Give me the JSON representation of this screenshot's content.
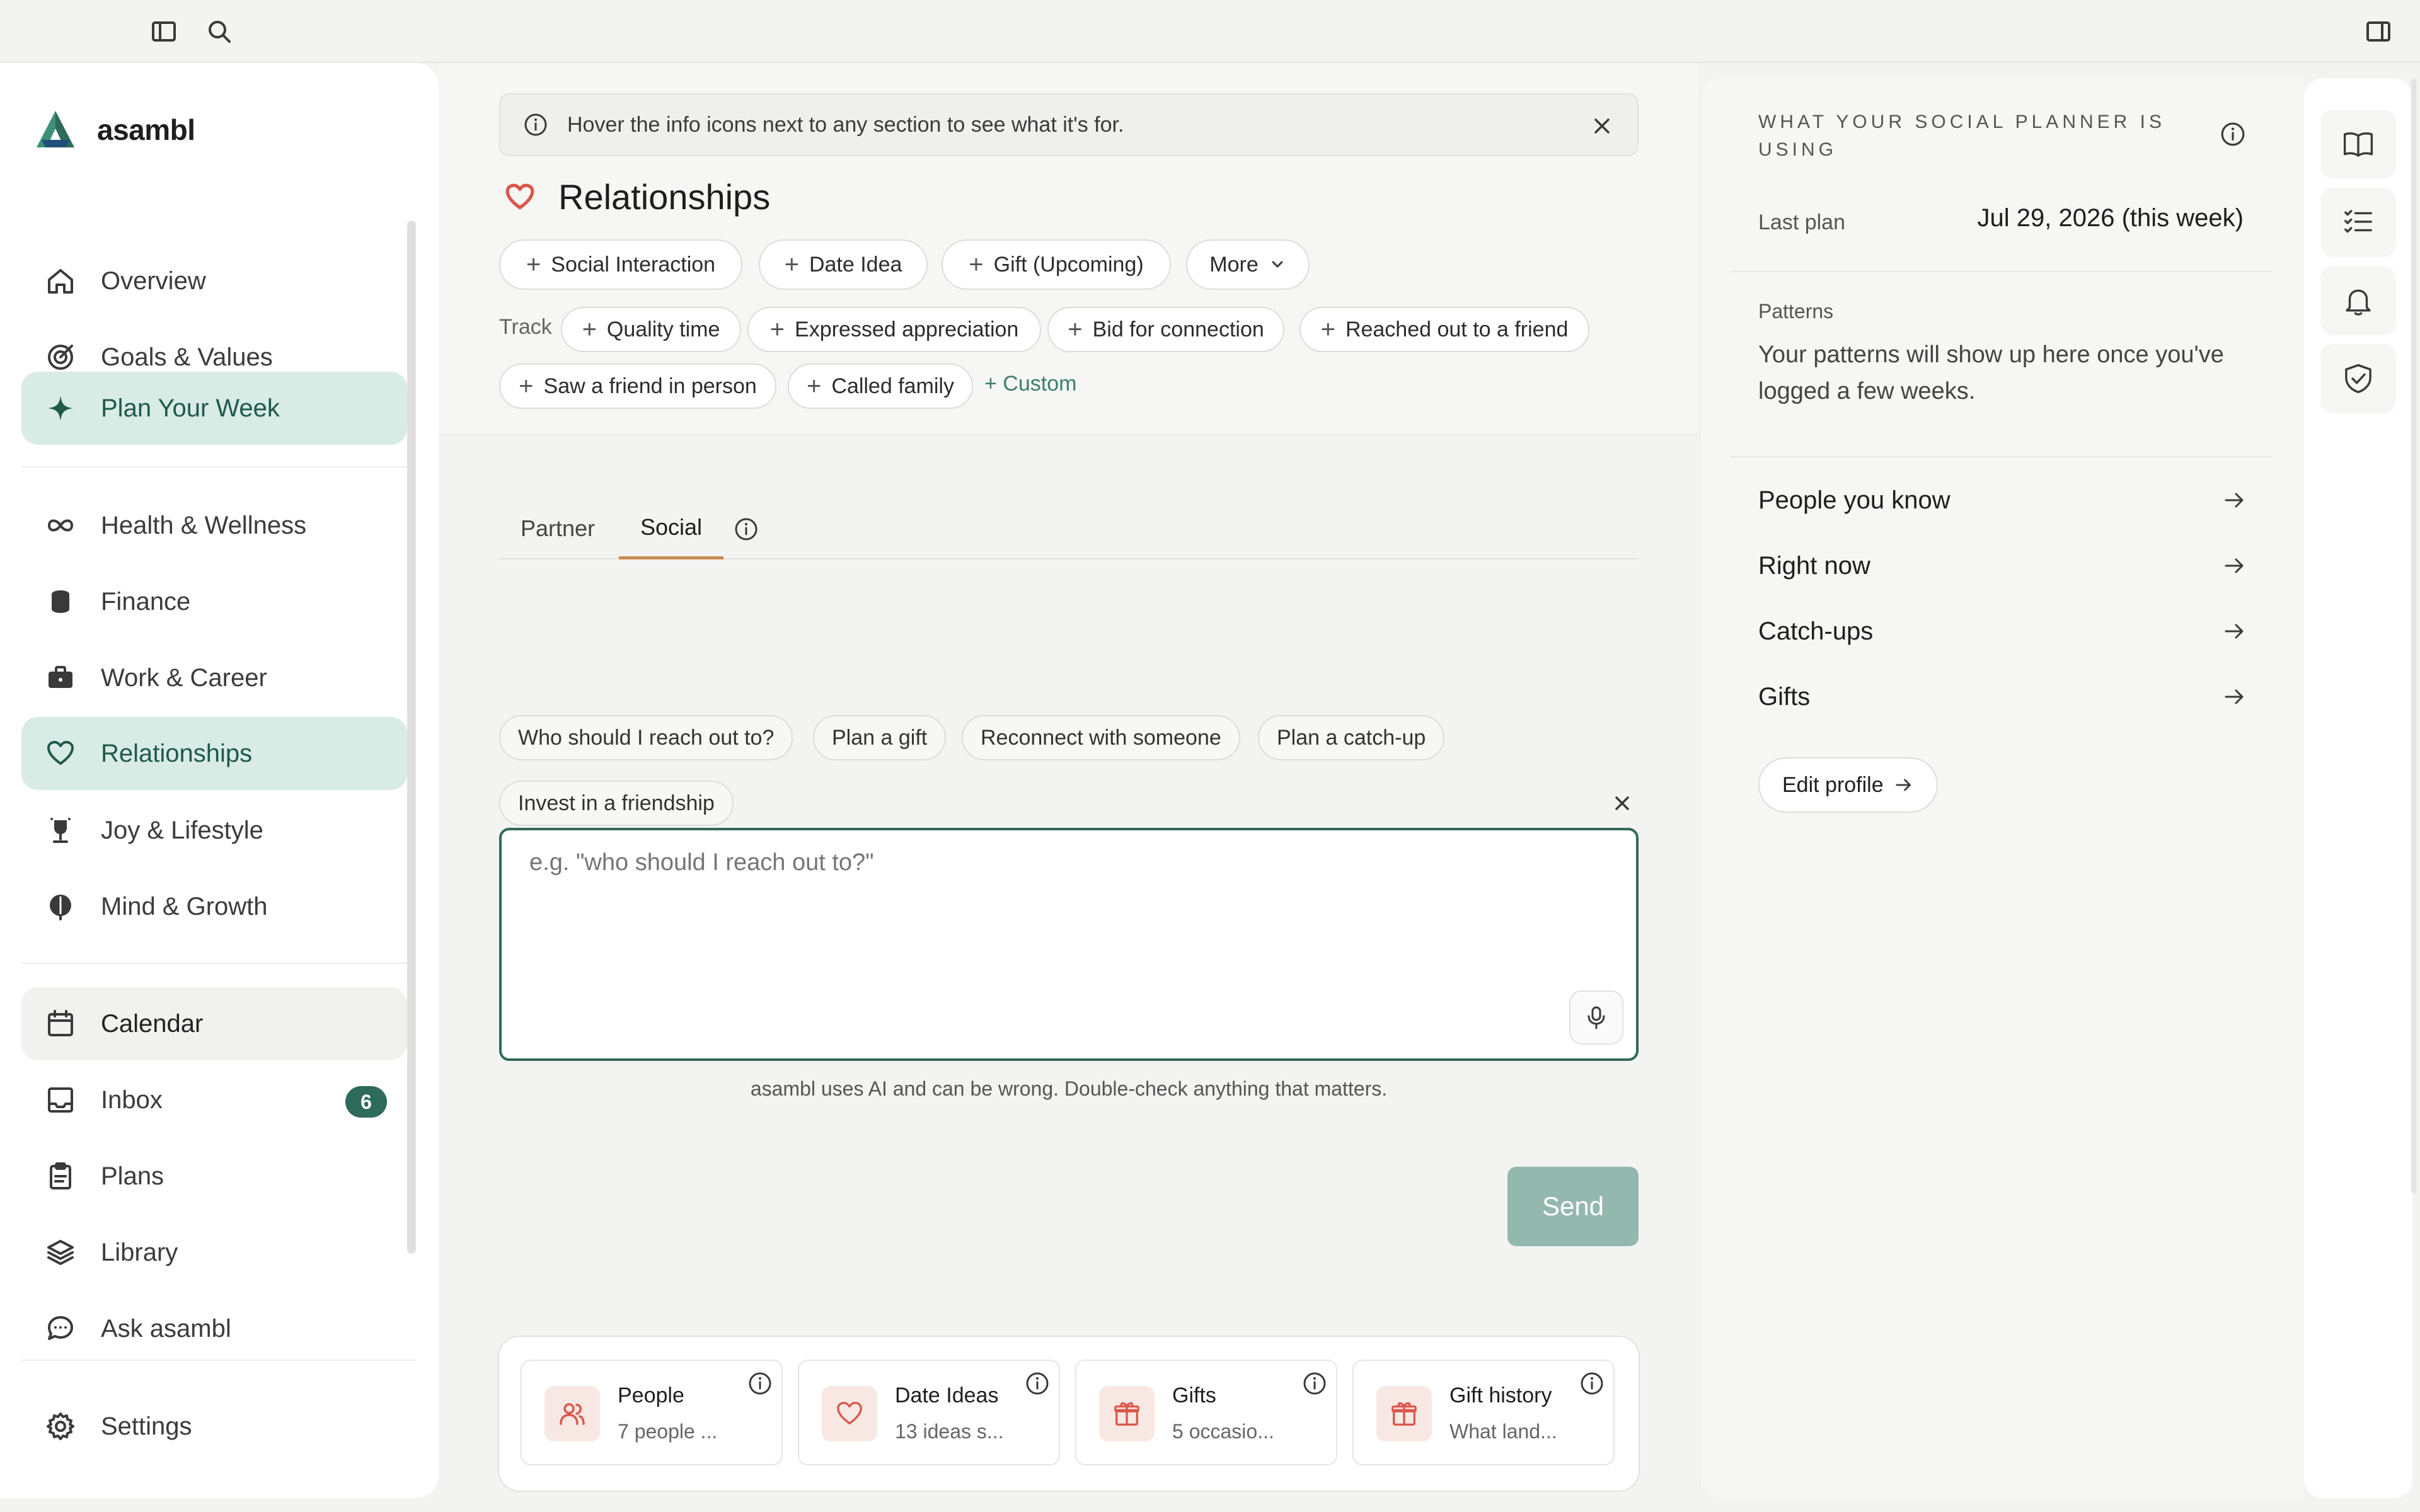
{
  "app": {
    "name": "asambl"
  },
  "nav": {
    "primary": [
      {
        "label": "Overview",
        "icon": "home-icon"
      },
      {
        "label": "Goals & Values",
        "icon": "target-icon"
      },
      {
        "label": "Plan Your Week",
        "icon": "sparkle-icon"
      }
    ],
    "areas": [
      {
        "label": "Health & Wellness",
        "icon": "infinity-icon"
      },
      {
        "label": "Finance",
        "icon": "coins-icon"
      },
      {
        "label": "Work & Career",
        "icon": "briefcase-icon"
      },
      {
        "label": "Relationships",
        "icon": "heart-icon"
      },
      {
        "label": "Joy & Lifestyle",
        "icon": "trophy-icon"
      },
      {
        "label": "Mind & Growth",
        "icon": "brain-icon"
      }
    ],
    "tools": [
      {
        "label": "Calendar",
        "icon": "calendar-icon"
      },
      {
        "label": "Inbox",
        "icon": "inbox-icon",
        "badge": "6"
      },
      {
        "label": "Plans",
        "icon": "clipboard-icon"
      },
      {
        "label": "Library",
        "icon": "layers-icon"
      },
      {
        "label": "Ask asambl",
        "icon": "chat-icon"
      }
    ],
    "settings": {
      "label": "Settings",
      "icon": "gear-icon"
    }
  },
  "banner": {
    "text": "Hover the info icons next to any section to see what it's for."
  },
  "page": {
    "title": "Relationships",
    "add_chips": [
      "Social Interaction",
      "Date Idea",
      "Gift (Upcoming)"
    ],
    "more_label": "More",
    "track_label": "Track",
    "track_chips": [
      "Quality time",
      "Expressed appreciation",
      "Bid for connection",
      "Reached out to a friend",
      "Saw a friend in person",
      "Called family"
    ],
    "custom_label": "+ Custom"
  },
  "tabs": [
    {
      "label": "Partner",
      "active": false
    },
    {
      "label": "Social",
      "active": true
    }
  ],
  "suggestions": [
    "Who should I reach out to?",
    "Plan a gift",
    "Reconnect with someone",
    "Plan a catch-up",
    "Invest in a friendship"
  ],
  "prompt": {
    "placeholder": "e.g. \"who should I reach out to?\"",
    "disclaimer": "asambl uses AI and can be wrong. Double-check anything that matters.",
    "send_label": "Send"
  },
  "quick_cards": [
    {
      "title": "People",
      "subtitle": "7 people ...",
      "icon": "people-icon"
    },
    {
      "title": "Date Ideas",
      "subtitle": "13 ideas s...",
      "icon": "heart-icon"
    },
    {
      "title": "Gifts",
      "subtitle": "5 occasio...",
      "icon": "gift-icon"
    },
    {
      "title": "Gift history",
      "subtitle": "What land...",
      "icon": "gift-icon"
    }
  ],
  "right_panel": {
    "title": "WHAT YOUR SOCIAL PLANNER IS USING",
    "last_plan_label": "Last plan",
    "last_plan_value": "Jul 29, 2026 (this week)",
    "patterns_label": "Patterns",
    "patterns_text": "Your patterns will show up here once you've logged a few weeks.",
    "links": [
      "People you know",
      "Right now",
      "Catch-ups",
      "Gifts"
    ],
    "edit_profile_label": "Edit profile"
  },
  "colors": {
    "accent": "#2f6a5b",
    "active_bg": "#d9ebe5",
    "heart": "#d9574a",
    "send_disabled": "#93b8ad",
    "tab_underline": "#c98a4e"
  }
}
